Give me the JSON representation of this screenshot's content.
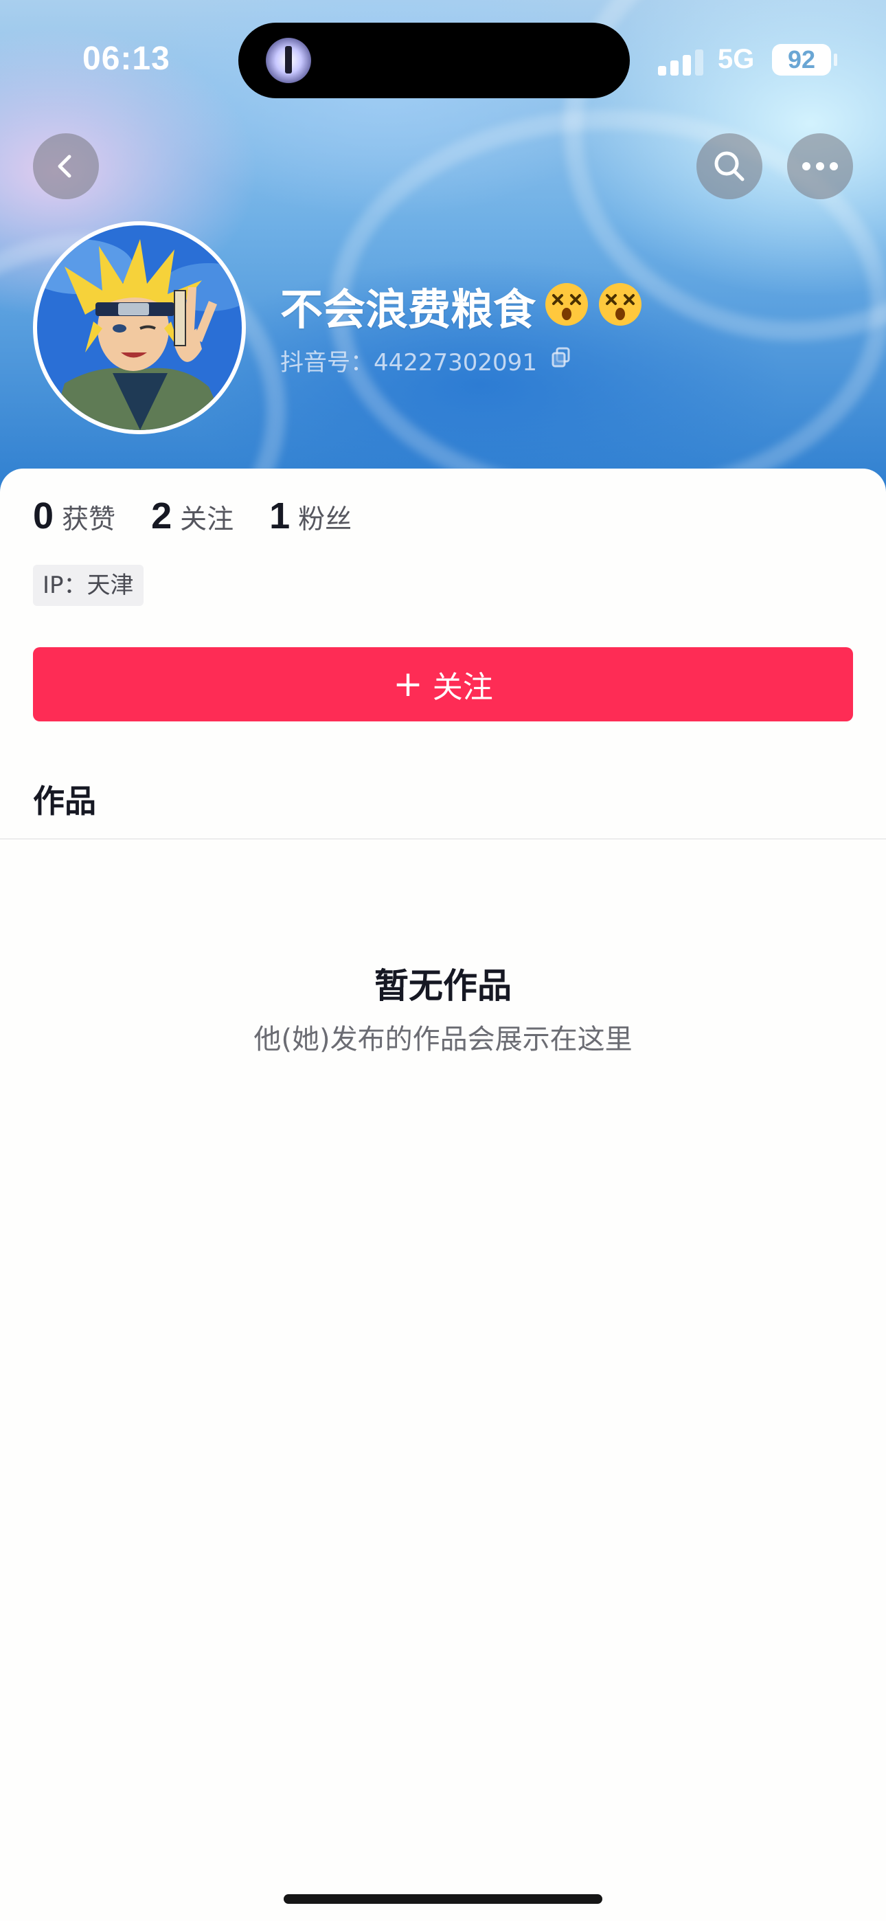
{
  "status_bar": {
    "time": "06:13",
    "network": "5G",
    "battery": "92"
  },
  "nav": {
    "back_icon": "chevron-left-icon",
    "search_icon": "search-icon",
    "more_icon": "more-horizontal-icon"
  },
  "profile": {
    "name": "不会浪费粮食",
    "emoji": [
      "dizzy-face-emoji",
      "dizzy-face-emoji"
    ],
    "id_label": "抖音号：",
    "id_value": "44227302091",
    "avatar": "anime-character-avatar"
  },
  "stats": [
    {
      "count": "0",
      "label": "获赞"
    },
    {
      "count": "2",
      "label": "关注"
    },
    {
      "count": "1",
      "label": "粉丝"
    }
  ],
  "ip": {
    "label": "IP：",
    "location": "天津"
  },
  "follow_button": {
    "icon": "+",
    "label": "关注",
    "color": "#fe2c55"
  },
  "tabs": {
    "works": "作品"
  },
  "empty_state": {
    "title": "暂无作品",
    "subtitle": "他(她)发布的作品会展示在这里"
  }
}
